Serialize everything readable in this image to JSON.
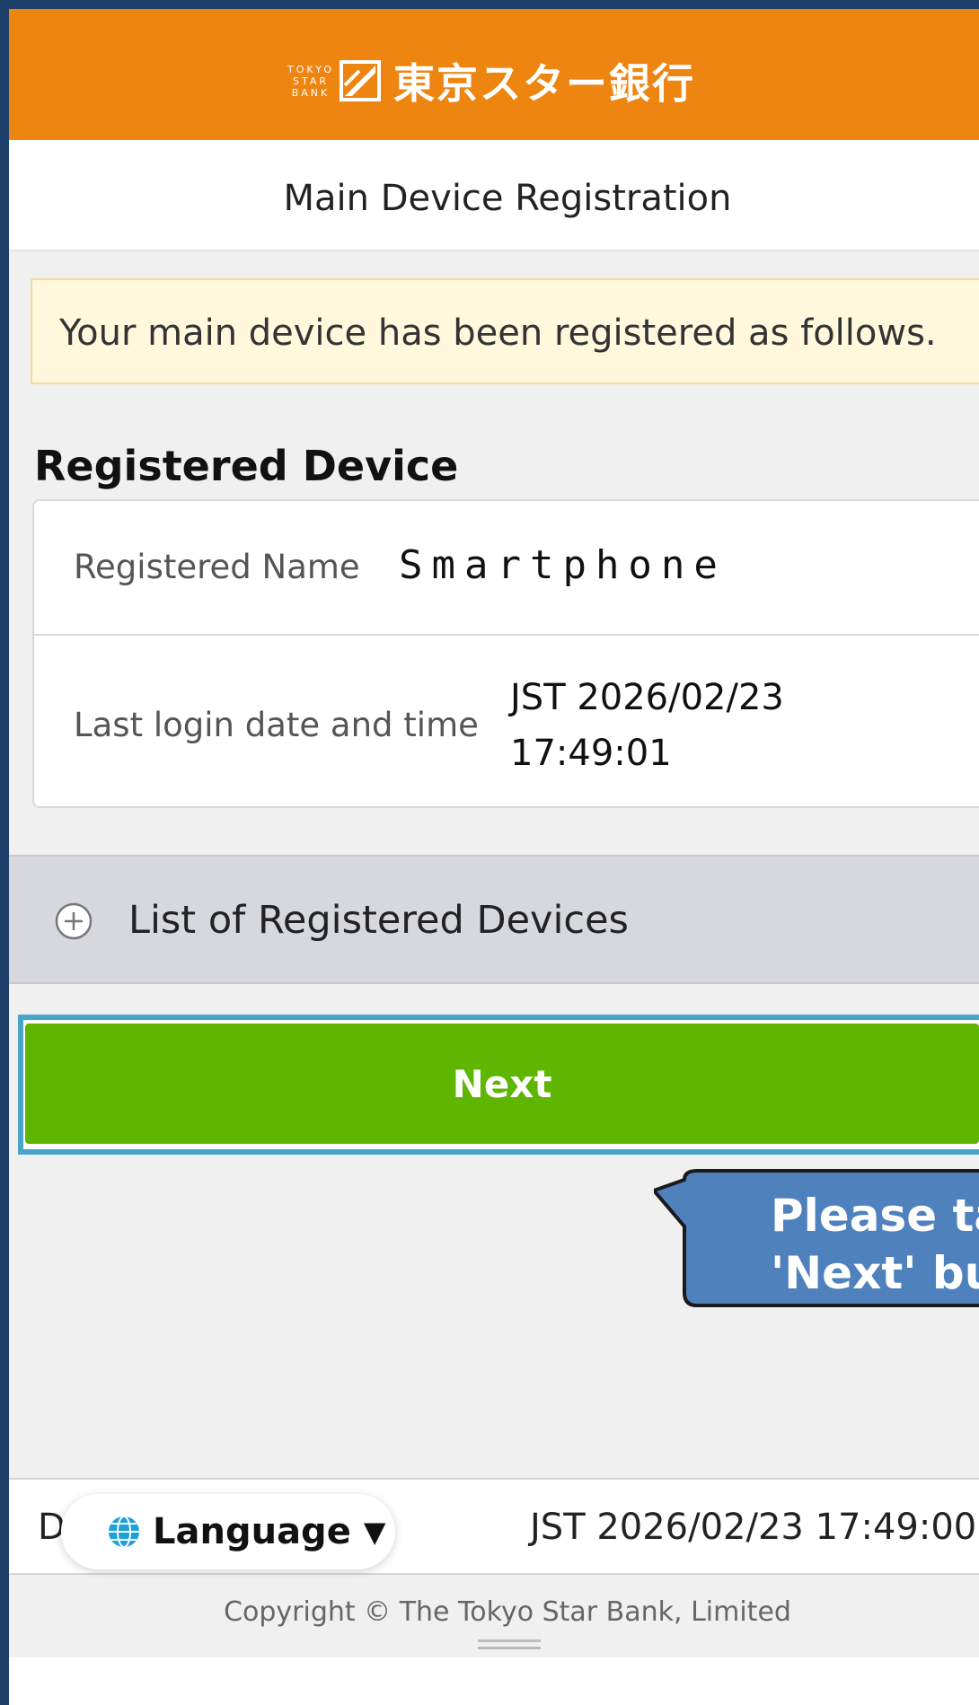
{
  "header": {
    "logo_en_lines": [
      "TOKYO",
      "STAR",
      "BANK"
    ],
    "logo_jp": "東京スター銀行",
    "brand_color": "#ef8511"
  },
  "page": {
    "title": "Main Device Registration"
  },
  "notice": {
    "text": "Your main device has been registered as follows."
  },
  "registered_device": {
    "heading": "Registered Device",
    "rows": [
      {
        "label": "Registered Name",
        "value": "Smartphone"
      },
      {
        "label": "Last login date and time",
        "value_line1": "JST 2026/02/23",
        "value_line2": "17:49:01"
      }
    ]
  },
  "devices_list": {
    "label": "List of Registered Devices",
    "icon": "plus-circle-icon"
  },
  "next_button": {
    "label": "Next",
    "color": "#5eb600",
    "highlight_color": "#4aa3c9"
  },
  "callout": {
    "line1": "Please ta",
    "line2": "'Next' bu",
    "color": "#4f81bd"
  },
  "footer": {
    "screen_code": "D",
    "language_label": "Language",
    "language_caret": "▼",
    "language_icon": "globe-icon",
    "timestamp": "JST 2026/02/23 17:49:00",
    "copyright": "Copyright © The Tokyo Star Bank, Limited"
  }
}
